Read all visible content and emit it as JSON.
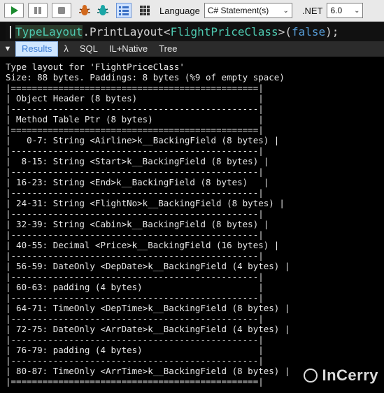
{
  "toolbar": {
    "icons": [
      "play-icon",
      "pause-icon",
      "stop-icon",
      "bug-icon",
      "bug-alt-icon",
      "grid-icon",
      "table-icon"
    ],
    "language_label": "Language",
    "language_value": "C# Statement(s)",
    "net_label": ".NET",
    "net_value": "6.0",
    "accent": "#1b8a2f"
  },
  "editor": {
    "code_parts": [
      "TypeLayout",
      ".PrintLayout<",
      "FlightPriceClass",
      ">(",
      "false",
      ");"
    ]
  },
  "results_tabs": {
    "collapse_icon": "triangle-down-icon",
    "tabs": [
      "Results",
      "λ",
      "SQL",
      "IL+Native",
      "Tree"
    ],
    "active": "Results"
  },
  "output": {
    "lines": [
      "Type layout for 'FlightPriceClass'",
      "Size: 88 bytes. Paddings: 8 bytes (%9 of empty space)",
      "|===============================================|",
      "| Object Header (8 bytes)                       |",
      "|-----------------------------------------------|",
      "| Method Table Ptr (8 bytes)                    |",
      "|===============================================|",
      "|   0-7: String <Airline>k__BackingField (8 bytes) |",
      "|-----------------------------------------------|",
      "|  8-15: String <Start>k__BackingField (8 bytes) |",
      "|-----------------------------------------------|",
      "| 16-23: String <End>k__BackingField (8 bytes)   |",
      "|-----------------------------------------------|",
      "| 24-31: String <FlightNo>k__BackingField (8 bytes) |",
      "|-----------------------------------------------|",
      "| 32-39: String <Cabin>k__BackingField (8 bytes) |",
      "|-----------------------------------------------|",
      "| 40-55: Decimal <Price>k__BackingField (16 bytes) |",
      "|-----------------------------------------------|",
      "| 56-59: DateOnly <DepDate>k__BackingField (4 bytes) |",
      "|-----------------------------------------------|",
      "| 60-63: padding (4 bytes)                      |",
      "|-----------------------------------------------|",
      "| 64-71: TimeOnly <DepTime>k__BackingField (8 bytes) |",
      "|-----------------------------------------------|",
      "| 72-75: DateOnly <ArrDate>k__BackingField (4 bytes) |",
      "|-----------------------------------------------|",
      "| 76-79: padding (4 bytes)                      |",
      "|-----------------------------------------------|",
      "| 80-87: TimeOnly <ArrTime>k__BackingField (8 bytes) |",
      "|===============================================|"
    ]
  },
  "watermark": {
    "text": "InCerry"
  }
}
